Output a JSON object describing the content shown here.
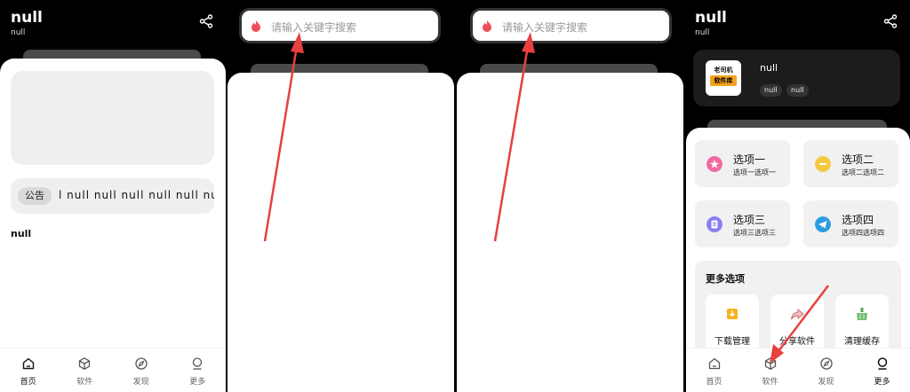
{
  "home": {
    "title": "null",
    "subtitle": "null",
    "notice_tag": "公告",
    "notice_text": "l  null  null  null  null  null  null  n",
    "section_title": "null"
  },
  "search": {
    "placeholder": "请输入关键字搜索"
  },
  "more": {
    "title": "null",
    "subtitle": "null",
    "logo_line1": "老司机",
    "logo_line2": "软件库",
    "user_name": "null",
    "badges": [
      "null",
      "null"
    ],
    "options": [
      {
        "title": "选项一",
        "subtitle": "选项一选项一",
        "color": "#f06aa0"
      },
      {
        "title": "选项二",
        "subtitle": "选项二选项二",
        "color": "#f5c842"
      },
      {
        "title": "选项三",
        "subtitle": "选项三选项三",
        "color": "#8a7cf0"
      },
      {
        "title": "选项四",
        "subtitle": "选项四选项四",
        "color": "#2a9de0"
      }
    ],
    "more_options_title": "更多选项",
    "tiles": [
      {
        "label": "下载管理",
        "icon": "download-icon"
      },
      {
        "label": "分享软件",
        "icon": "share-arrow-icon"
      },
      {
        "label": "清理缓存",
        "icon": "broom-icon"
      }
    ]
  },
  "tabbar": {
    "tabs": [
      {
        "label": "首页",
        "icon": "home-icon"
      },
      {
        "label": "软件",
        "icon": "cube-icon"
      },
      {
        "label": "发现",
        "icon": "compass-icon"
      },
      {
        "label": "更多",
        "icon": "person-icon"
      }
    ]
  },
  "colors": {
    "annotation_arrow": "#e84040",
    "accent_orange": "#f3a21c"
  }
}
